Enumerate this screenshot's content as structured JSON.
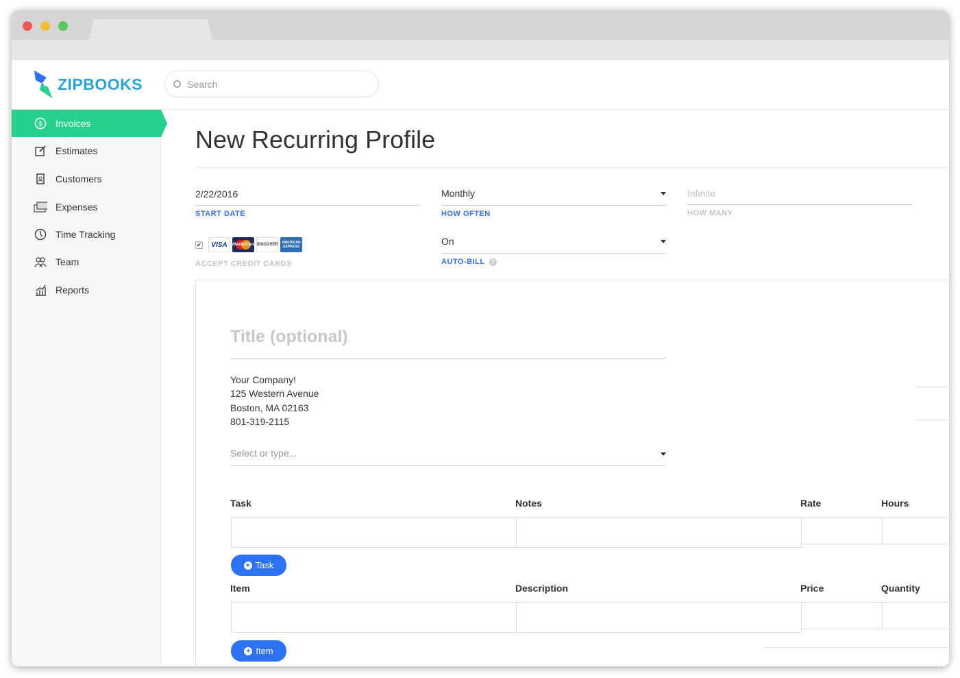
{
  "brand": {
    "name": "ZIPBOOKS",
    "color": "#2aa3d8"
  },
  "search": {
    "placeholder": "Search"
  },
  "sidebar": {
    "active_color": "#26d18c",
    "items": [
      {
        "label": "Invoices",
        "icon": "dollar-circle-icon",
        "active": true
      },
      {
        "label": "Estimates",
        "icon": "edit-icon"
      },
      {
        "label": "Customers",
        "icon": "contact-card-icon"
      },
      {
        "label": "Expenses",
        "icon": "money-stack-icon"
      },
      {
        "label": "Time Tracking",
        "icon": "clock-icon"
      },
      {
        "label": "Team",
        "icon": "users-icon"
      },
      {
        "label": "Reports",
        "icon": "bar-chart-icon"
      }
    ]
  },
  "page": {
    "title": "New Recurring Profile"
  },
  "form": {
    "start_date": {
      "value": "2/22/2016",
      "label": "START DATE"
    },
    "how_often": {
      "value": "Monthly",
      "label": "HOW OFTEN"
    },
    "how_many": {
      "placeholder": "Infinite",
      "label": "HOW MANY"
    },
    "credit_cards": {
      "checked": true,
      "label": "ACCEPT CREDIT CARDS",
      "cards": [
        "VISA",
        "MasterCard",
        "DISCOVER",
        "AMERICAN EXPRESS"
      ]
    },
    "auto_bill": {
      "value": "On",
      "label": "AUTO-BILL"
    }
  },
  "invoice": {
    "title_placeholder": "Title (optional)",
    "company": [
      "Your Company!",
      "125 Western Avenue",
      "Boston, MA 02163",
      "801-319-2115"
    ],
    "customer_placeholder": "Select or type...",
    "task_headers": [
      "Task",
      "Notes",
      "Rate",
      "Hours"
    ],
    "add_task": "Task",
    "item_headers": [
      "Item",
      "Description",
      "Price",
      "Quantity"
    ],
    "add_item": "Item"
  },
  "accent": "#2d72f5"
}
